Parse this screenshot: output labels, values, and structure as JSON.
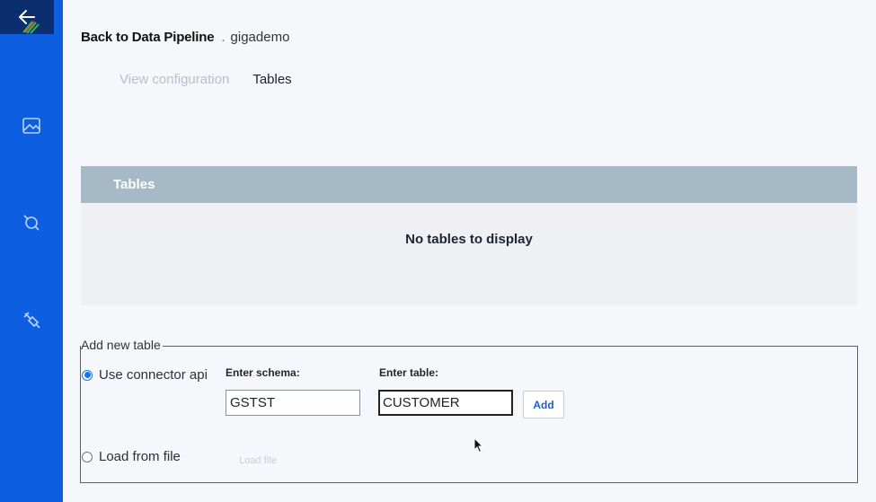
{
  "nav": {
    "back_icon": "arrow-left-icon",
    "items": [
      {
        "icon": "image-icon"
      },
      {
        "icon": "connector-icon"
      },
      {
        "icon": "plug-icon"
      }
    ]
  },
  "breadcrumb": {
    "back_label": "Back to Data Pipeline",
    "separator": ".",
    "pipeline_name": "gigademo"
  },
  "tabs": [
    {
      "label": "View configuration",
      "active": false
    },
    {
      "label": "Tables",
      "active": true
    }
  ],
  "tables_panel": {
    "header": "Tables",
    "empty_message": "No tables to display"
  },
  "add_table": {
    "legend": "Add new table",
    "option_connector": "Use connector api",
    "option_file": "Load from file",
    "schema_label": "Enter schema:",
    "schema_value": "GSTST",
    "table_label": "Enter table:",
    "table_value": "CUSTOMER",
    "add_label": "Add",
    "load_file_label": "Load file"
  },
  "colors": {
    "rail": "#0d5ee1",
    "back_button": "#0b2f6e",
    "table_header": "#a6b9c6",
    "accent": "#1a73e8"
  }
}
